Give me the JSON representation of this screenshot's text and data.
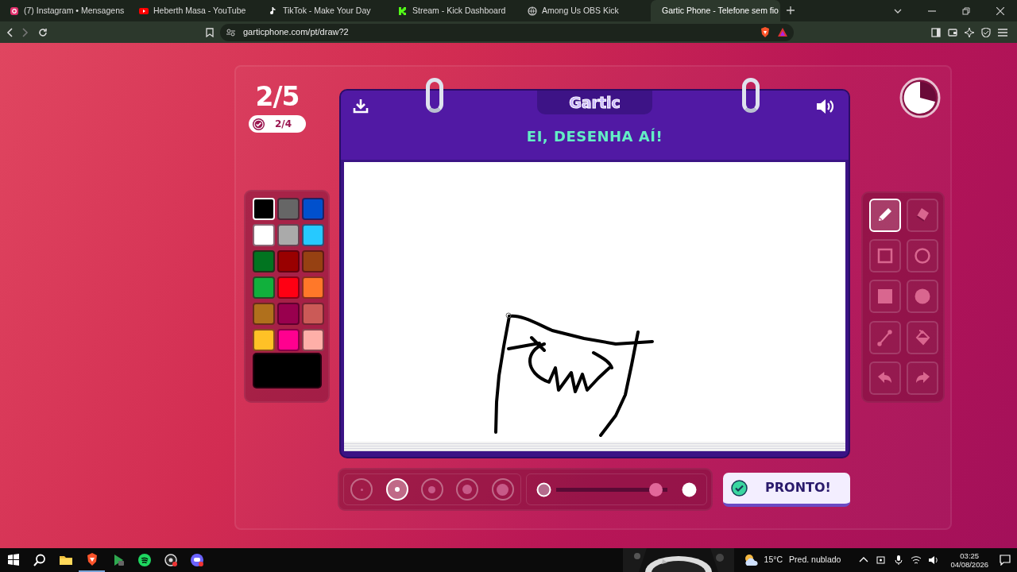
{
  "browser": {
    "tabs": [
      {
        "title": "(7) Instagram • Mensagens",
        "selected": false
      },
      {
        "title": "Heberth Masa - YouTube",
        "selected": false
      },
      {
        "title": "TikTok - Make Your Day",
        "selected": false
      },
      {
        "title": "Stream - Kick Dashboard",
        "selected": false
      },
      {
        "title": "Among Us OBS Kick",
        "selected": false
      },
      {
        "title": "Gartic Phone - Telefone sem fio",
        "selected": true
      }
    ],
    "address": "garticphone.com/pt/draw?2"
  },
  "game": {
    "round": "2/5",
    "done": "2/4",
    "logo": "Gartic",
    "prompt": "EI, DESENHA AÍ!",
    "palette": [
      {
        "color": "#000000",
        "selected": true
      },
      {
        "color": "#666666",
        "selected": false
      },
      {
        "color": "#0050cd",
        "selected": false
      },
      {
        "color": "#ffffff",
        "selected": false
      },
      {
        "color": "#aaaaaa",
        "selected": false
      },
      {
        "color": "#26c9ff",
        "selected": false
      },
      {
        "color": "#017420",
        "selected": false
      },
      {
        "color": "#990000",
        "selected": false
      },
      {
        "color": "#964112",
        "selected": false
      },
      {
        "color": "#11b03c",
        "selected": false
      },
      {
        "color": "#ff0013",
        "selected": false
      },
      {
        "color": "#ff7829",
        "selected": false
      },
      {
        "color": "#b0701c",
        "selected": false
      },
      {
        "color": "#99004e",
        "selected": false
      },
      {
        "color": "#cb5a57",
        "selected": false
      },
      {
        "color": "#ffc126",
        "selected": false
      },
      {
        "color": "#ff008f",
        "selected": false
      },
      {
        "color": "#feafa8",
        "selected": false
      }
    ],
    "tools": [
      {
        "kind": "pencil",
        "selected": true
      },
      {
        "kind": "eraser",
        "selected": false
      },
      {
        "kind": "rect",
        "selected": false
      },
      {
        "kind": "ellipse",
        "selected": false
      },
      {
        "kind": "filled-rect",
        "selected": false
      },
      {
        "kind": "filled-ellipse",
        "selected": false
      },
      {
        "kind": "line",
        "selected": false
      },
      {
        "kind": "bucket",
        "selected": false
      },
      {
        "kind": "undo",
        "selected": false
      },
      {
        "kind": "redo",
        "selected": false
      }
    ],
    "brush_sizes": [
      {
        "selected": false
      },
      {
        "selected": true
      },
      {
        "selected": false
      },
      {
        "selected": false
      },
      {
        "selected": false
      }
    ],
    "opacity": {
      "level": 0.95
    },
    "done_button": "PRONTO!"
  },
  "taskbar": {
    "temperature": "15°C",
    "weather": "Pred. nublado",
    "time": "03:25",
    "date": "04/08/2026"
  }
}
